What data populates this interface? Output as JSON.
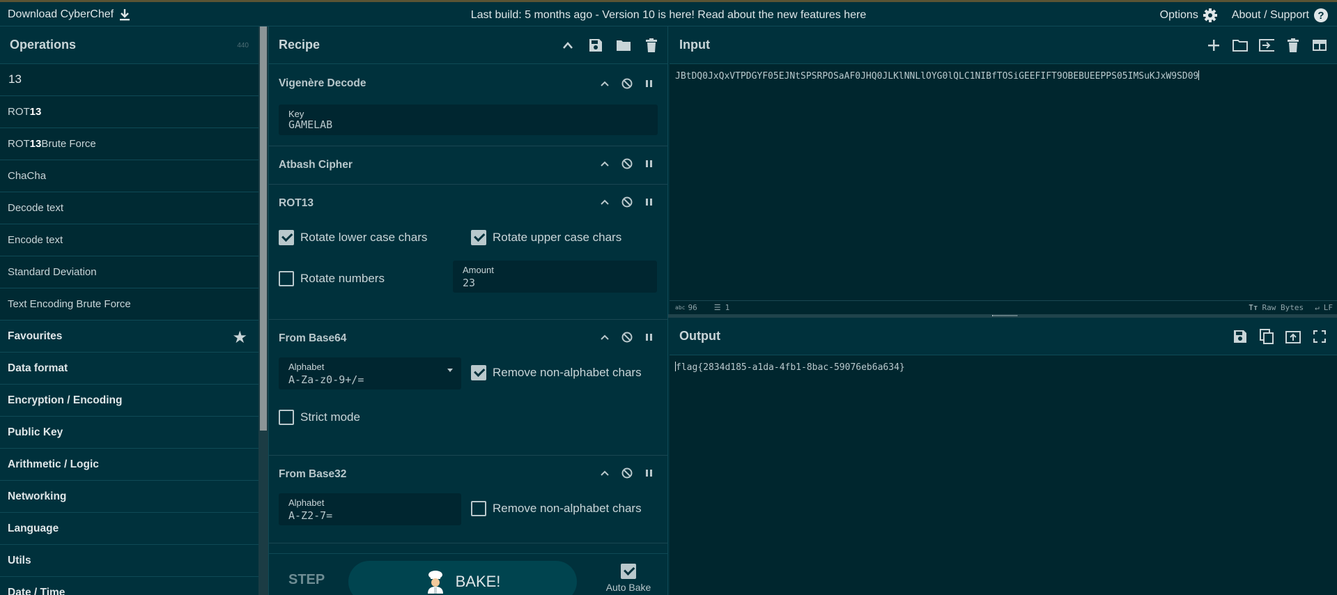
{
  "topbar": {
    "download_label": "Download CyberChef",
    "announcement_prefix": "Last build: 5 months ago - Version 10 is here! Read about the new features ",
    "announcement_link": "here",
    "options_label": "Options",
    "about_label": "About / Support"
  },
  "operations": {
    "title": "Operations",
    "count": "440",
    "search_value": "13",
    "results": [
      {
        "pre": "ROT",
        "match": "13",
        "post": ""
      },
      {
        "pre": "ROT",
        "match": "13",
        "post": " Brute Force"
      },
      {
        "pre": "ChaCha",
        "match": "",
        "post": ""
      },
      {
        "pre": "Decode text",
        "match": "",
        "post": ""
      },
      {
        "pre": "Encode text",
        "match": "",
        "post": ""
      },
      {
        "pre": "Standard Deviation",
        "match": "",
        "post": ""
      },
      {
        "pre": "Text Encoding Brute Force",
        "match": "",
        "post": ""
      }
    ],
    "categories": [
      "Favourites",
      "Data format",
      "Encryption / Encoding",
      "Public Key",
      "Arithmetic / Logic",
      "Networking",
      "Language",
      "Utils",
      "Date / Time"
    ]
  },
  "recipe": {
    "title": "Recipe",
    "ops": {
      "vigenere": {
        "title": "Vigenère Decode",
        "key_label": "Key",
        "key_value": "GAMELAB"
      },
      "atbash": {
        "title": "Atbash Cipher"
      },
      "rot13": {
        "title": "ROT13",
        "lower_label": "Rotate lower case chars",
        "lower_checked": true,
        "upper_label": "Rotate upper case chars",
        "upper_checked": true,
        "numbers_label": "Rotate numbers",
        "numbers_checked": false,
        "amount_label": "Amount",
        "amount_value": "23"
      },
      "base64": {
        "title": "From Base64",
        "alphabet_label": "Alphabet",
        "alphabet_value": "A-Za-z0-9+/=",
        "remove_label": "Remove non-alphabet chars",
        "remove_checked": true,
        "strict_label": "Strict mode",
        "strict_checked": false
      },
      "base32": {
        "title": "From Base32",
        "alphabet_label": "Alphabet",
        "alphabet_value": "A-Z2-7=",
        "remove_label": "Remove non-alphabet chars",
        "remove_checked": false
      }
    },
    "step_label": "STEP",
    "bake_label": "BAKE!",
    "autobake_label": "Auto Bake",
    "autobake_checked": true
  },
  "input": {
    "title": "Input",
    "text": "JBtDQ0JxQxVTPDGYF05EJNtSPSRPOSaAF0JHQ0JLKlNNLlOYG0lQLC1NIBfTOSiGEEFIFT9OBEBUEEPPS05IMSuKJxW9SD09",
    "status_chars": "96",
    "status_lines": "1",
    "encoding": "Raw Bytes",
    "eol": "LF"
  },
  "output": {
    "title": "Output",
    "text": "flag{2834d185-a1da-4fb1-8bac-59076eb6a634}"
  }
}
